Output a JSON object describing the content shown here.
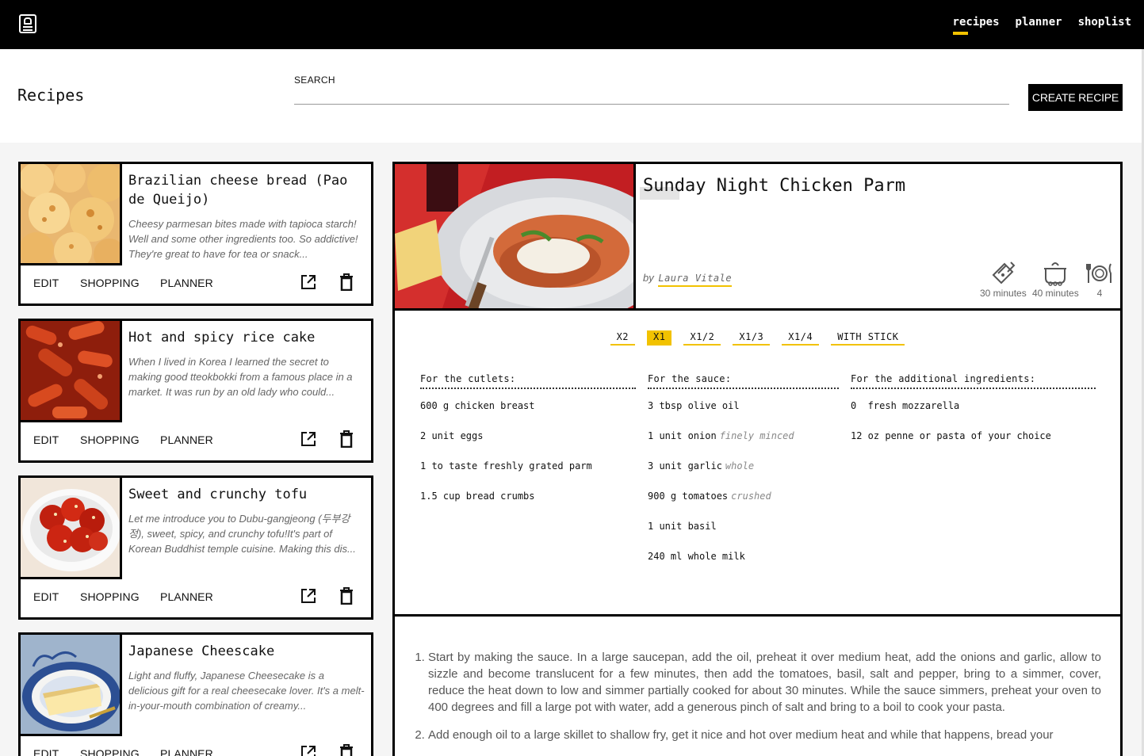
{
  "nav": {
    "links": [
      "recipes",
      "planner",
      "shoplist"
    ]
  },
  "header": {
    "title": "Recipes",
    "search_label": "SEARCH",
    "search_value": "",
    "create_label": "CREATE RECIPE"
  },
  "cards": [
    {
      "title": "Brazilian cheese bread (Pao de Queijo)",
      "description": "Cheesy parmesan bites made with tapioca starch! Well and some other ingredients too. So addictive! They're great to have for tea or snack...",
      "edit": "EDIT",
      "shopping": "SHOPPING",
      "planner": "PLANNER"
    },
    {
      "title": "Hot and spicy rice cake",
      "description": "When I lived in Korea I learned the secret to making good tteokbokki from a famous place in a market. It was run by an old lady who could...",
      "edit": "EDIT",
      "shopping": "SHOPPING",
      "planner": "PLANNER"
    },
    {
      "title": "Sweet and crunchy tofu",
      "description": "Let me introduce you to Dubu-gangjeong (두부강정), sweet, spicy, and crunchy tofu!It's part of Korean Buddhist temple cuisine. Making this dis...",
      "edit": "EDIT",
      "shopping": "SHOPPING",
      "planner": "PLANNER"
    },
    {
      "title": "Japanese Cheescake",
      "description": "Light and fluffy, Japanese Cheesecake is a delicious gift for a real cheesecake lover. It's a melt-in-your-mouth combination of creamy...",
      "edit": "EDIT",
      "shopping": "SHOPPING",
      "planner": "PLANNER"
    }
  ],
  "detail": {
    "title": "Sunday Night Chicken Parm",
    "by": "by",
    "author": "Laura Vitale",
    "prep_time": "30 minutes",
    "cook_time": "40 minutes",
    "servings": "4",
    "portions": [
      "X2",
      "X1",
      "X1/2",
      "X1/3",
      "X1/4",
      "WITH STICK"
    ],
    "active_portion": "X1",
    "ingredient_groups": [
      {
        "heading": "For the cutlets:",
        "items": [
          {
            "text": "600 g chicken breast",
            "note": ""
          },
          {
            "text": "2 unit eggs",
            "note": ""
          },
          {
            "text": "1 to taste freshly grated parm",
            "note": ""
          },
          {
            "text": "1.5 cup bread crumbs",
            "note": ""
          }
        ]
      },
      {
        "heading": "For the sauce:",
        "items": [
          {
            "text": "3 tbsp olive oil",
            "note": ""
          },
          {
            "text": "1 unit onion",
            "note": "finely minced"
          },
          {
            "text": "3 unit garlic",
            "note": "whole"
          },
          {
            "text": "900 g tomatoes",
            "note": "crushed"
          },
          {
            "text": "1 unit basil",
            "note": ""
          },
          {
            "text": "240 ml whole milk",
            "note": ""
          }
        ]
      },
      {
        "heading": "For the additional ingredients:",
        "items": [
          {
            "text": "0  fresh mozzarella",
            "note": ""
          },
          {
            "text": "12 oz penne or pasta of your choice",
            "note": ""
          }
        ]
      }
    ],
    "steps": [
      "Start by making the sauce. In a large saucepan, add the oil, preheat it over medium heat, add the onions and garlic, allow to sizzle and become translucent for a few minutes, then add the tomatoes, basil, salt and pepper, bring to a simmer, cover, reduce the heat down to low and simmer partially cooked for about 30 minutes. While the sauce simmers, preheat your oven to 400 degrees and fill a large pot with water, add a generous pinch of salt and bring to a boil to cook your pasta.",
      "Add enough oil to a large skillet to shallow fry, get it nice and hot over medium heat and while that happens, bread your"
    ]
  },
  "colors": {
    "accent": "#f2c200",
    "border": "#000000",
    "muted_text": "#666666"
  }
}
